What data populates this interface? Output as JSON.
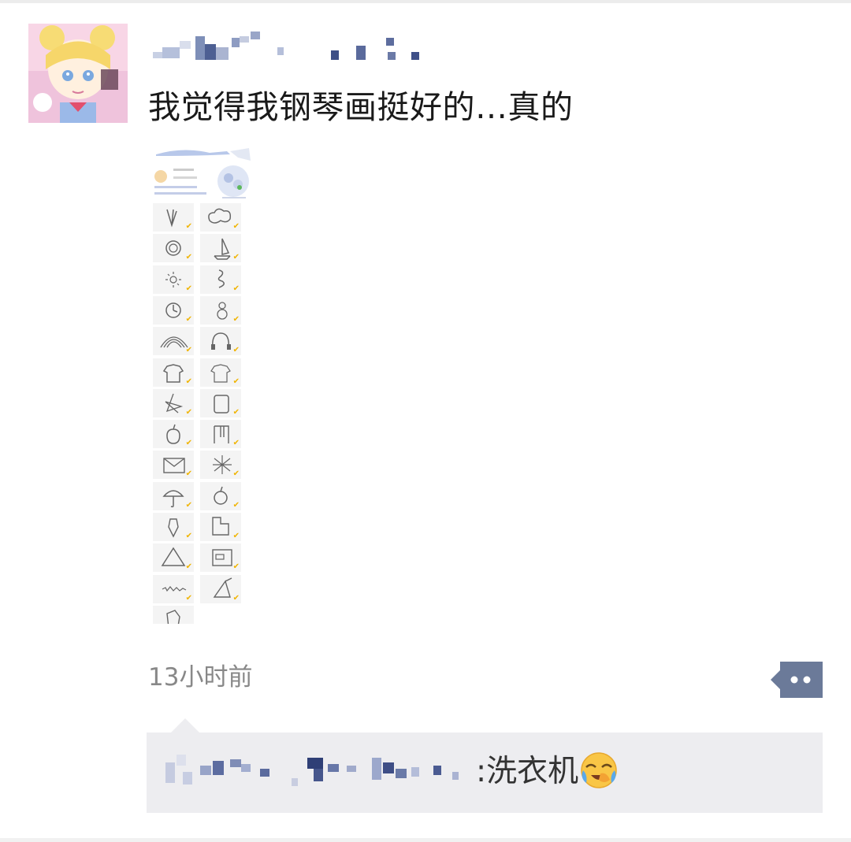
{
  "post": {
    "text": "我觉得我钢琴画挺好的…真的",
    "time": "13小时前"
  },
  "comment": {
    "separator": ":",
    "text": "洗衣机"
  },
  "icons": {
    "more": "more-dots-icon",
    "emoji": "face-with-tears-emoji-icon"
  },
  "colors": {
    "more_button": "#6b7a99",
    "comment_bg": "#ededf0",
    "check": "#f0b400"
  }
}
